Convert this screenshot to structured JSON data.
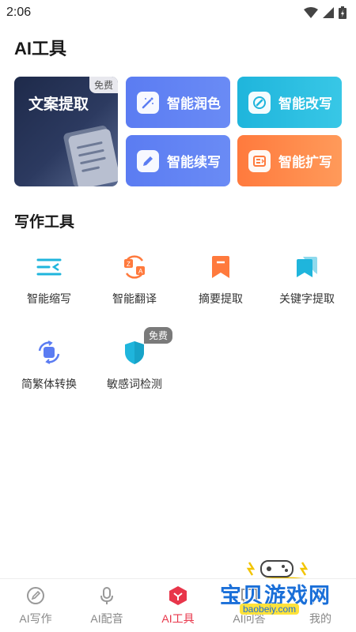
{
  "status": {
    "time": "2:06"
  },
  "ai_section": {
    "title": "AI工具",
    "big_card": {
      "label": "文案提取",
      "tag": "免费"
    },
    "cards": [
      {
        "label": "智能润色",
        "icon": "magic-wand-icon"
      },
      {
        "label": "智能改写",
        "icon": "edit-pen-icon"
      },
      {
        "label": "智能续写",
        "icon": "pencil-icon"
      },
      {
        "label": "智能扩写",
        "icon": "expand-text-icon"
      }
    ]
  },
  "write_section": {
    "title": "写作工具",
    "tools": [
      {
        "label": "智能缩写",
        "icon": "shorten-icon"
      },
      {
        "label": "智能翻译",
        "icon": "translate-icon"
      },
      {
        "label": "摘要提取",
        "icon": "bookmark-icon"
      },
      {
        "label": "关键字提取",
        "icon": "keyword-icon"
      },
      {
        "label": "简繁体转换",
        "icon": "convert-icon"
      },
      {
        "label": "敏感词检测",
        "icon": "shield-icon"
      }
    ],
    "free_tag": "免费"
  },
  "tabs": [
    {
      "label": "AI写作",
      "icon": "pen-circle-icon"
    },
    {
      "label": "AI配音",
      "icon": "microphone-icon"
    },
    {
      "label": "AI工具",
      "icon": "cube-icon",
      "active": true
    },
    {
      "label": "AI问答",
      "icon": "chat-icon"
    },
    {
      "label": "我的",
      "icon": "user-icon"
    }
  ],
  "watermark": {
    "text": "宝贝游戏网",
    "url": "baobeiy.com"
  },
  "colors": {
    "accent": "#e8354a",
    "blue": "#5b7cf2",
    "cyan": "#1fb5dc",
    "orange": "#ff7a3d"
  }
}
